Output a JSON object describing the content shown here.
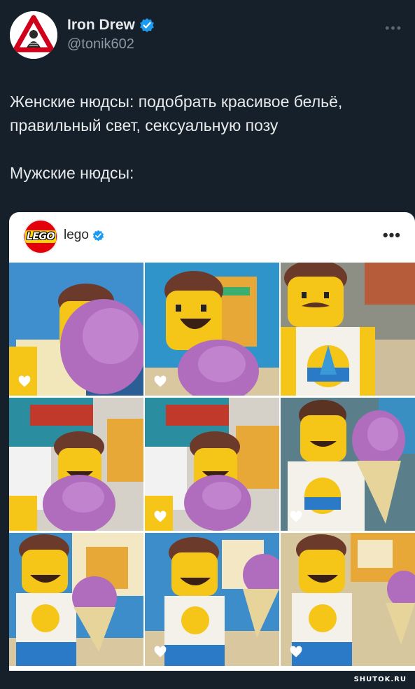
{
  "tweet": {
    "display_name": "Iron Drew",
    "handle": "@tonik602",
    "more_icon": "more-horizontal-icon",
    "verified_icon": "verified-badge-icon",
    "text_line1": "Женские нюдсы: подобрать красивое бельё, правильный свет, сексуальную позу",
    "text_line2": "Мужские нюдсы:"
  },
  "embed": {
    "account_name": "lego",
    "logo_text": "LEGO",
    "more_icon": "more-horizontal-icon",
    "tiles": [
      {
        "scene": "minifig-closeup-ice-cream-blur",
        "liked_icon": "heart-icon"
      },
      {
        "scene": "minifig-laughing-ice-cream",
        "liked_icon": "heart-icon"
      },
      {
        "scene": "minifig-mustache-shirt",
        "liked_icon": ""
      },
      {
        "scene": "minifig-shop-background",
        "liked_icon": ""
      },
      {
        "scene": "minifig-shop-background-2",
        "liked_icon": "heart-icon"
      },
      {
        "scene": "minifig-holding-ice-cream",
        "liked_icon": "heart-icon"
      },
      {
        "scene": "minifig-full-body-ice-cream",
        "liked_icon": ""
      },
      {
        "scene": "minifig-full-body-laughing",
        "liked_icon": "heart-icon"
      },
      {
        "scene": "minifig-full-body-cone",
        "liked_icon": "heart-icon"
      }
    ]
  },
  "watermark": "SHUTOK.RU",
  "colors": {
    "background": "#15202b",
    "text": "#e7e9ea",
    "muted": "#8b98a5",
    "verified": "#1d9bf0",
    "lego_red": "#e3000b"
  }
}
